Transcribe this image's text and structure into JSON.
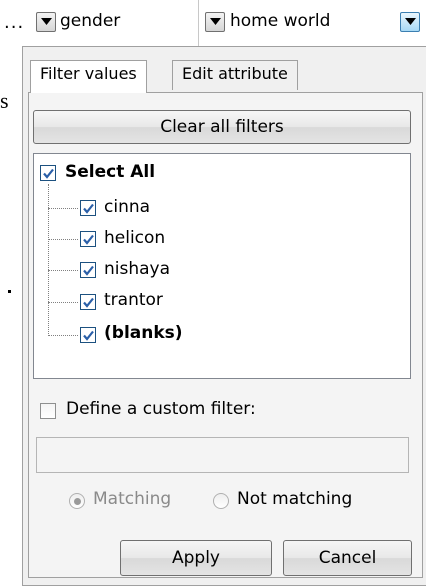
{
  "header": {
    "ellipsis": "...",
    "columns": [
      {
        "label": "gender"
      },
      {
        "label": "home world"
      }
    ]
  },
  "side_text": "s",
  "filter_panel": {
    "tabs": [
      {
        "label": "Filter values",
        "active": true
      },
      {
        "label": "Edit attribute",
        "active": false
      }
    ],
    "clear_all_label": "Clear all filters",
    "select_all": {
      "label": "Select All",
      "checked": true
    },
    "values": [
      {
        "label": "cinna",
        "checked": true
      },
      {
        "label": "helicon",
        "checked": true
      },
      {
        "label": "nishaya",
        "checked": true
      },
      {
        "label": "trantor",
        "checked": true
      },
      {
        "label": "(blanks)",
        "checked": true
      }
    ],
    "custom_filter": {
      "label": "Define a custom filter:",
      "checked": false,
      "value": ""
    },
    "match_options": [
      {
        "label": "Matching",
        "selected": true,
        "enabled": false
      },
      {
        "label": "Not matching",
        "selected": false,
        "enabled": true
      }
    ],
    "apply_label": "Apply",
    "cancel_label": "Cancel"
  },
  "colors": {
    "panel_bg": "#f0f0f0",
    "checkbox_check": "#2a5fa8",
    "active_dropdown": "#a7d9f5"
  }
}
